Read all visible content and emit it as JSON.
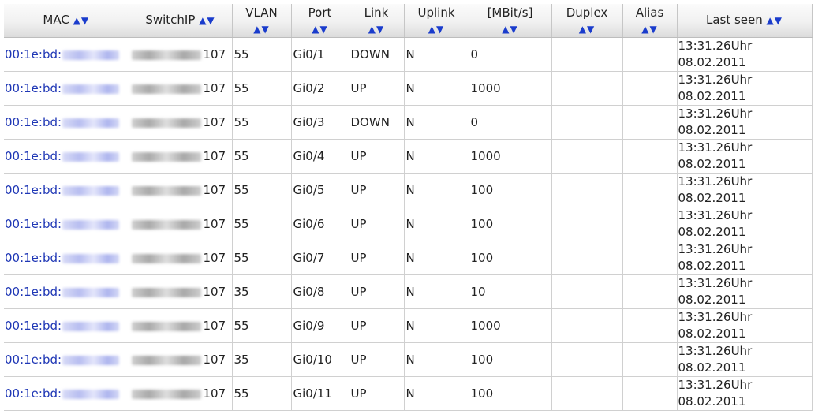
{
  "table": {
    "headers": {
      "mac": "MAC",
      "switchip": "SwitchIP",
      "vlan": "VLAN",
      "port": "Port",
      "link": "Link",
      "uplink": "Uplink",
      "speed": "[MBit/s]",
      "duplex": "Duplex",
      "alias": "Alias",
      "last_seen": "Last seen"
    },
    "sort_arrows": "▲▼",
    "rows": [
      {
        "mac_prefix": "00:1e:bd:",
        "ip_suffix": "107",
        "vlan": "55",
        "port": "Gi0/1",
        "link": "DOWN",
        "uplink": "N",
        "speed": "0",
        "duplex": "",
        "alias": "",
        "time": "13:31.26Uhr",
        "date": "08.02.2011"
      },
      {
        "mac_prefix": "00:1e:bd:",
        "ip_suffix": "107",
        "vlan": "55",
        "port": "Gi0/2",
        "link": "UP",
        "uplink": "N",
        "speed": "1000",
        "duplex": "",
        "alias": "",
        "time": "13:31.26Uhr",
        "date": "08.02.2011"
      },
      {
        "mac_prefix": "00:1e:bd:",
        "ip_suffix": "107",
        "vlan": "55",
        "port": "Gi0/3",
        "link": "DOWN",
        "uplink": "N",
        "speed": "0",
        "duplex": "",
        "alias": "",
        "time": "13:31.26Uhr",
        "date": "08.02.2011"
      },
      {
        "mac_prefix": "00:1e:bd:",
        "ip_suffix": "107",
        "vlan": "55",
        "port": "Gi0/4",
        "link": "UP",
        "uplink": "N",
        "speed": "1000",
        "duplex": "",
        "alias": "",
        "time": "13:31.26Uhr",
        "date": "08.02.2011"
      },
      {
        "mac_prefix": "00:1e:bd:",
        "ip_suffix": "107",
        "vlan": "55",
        "port": "Gi0/5",
        "link": "UP",
        "uplink": "N",
        "speed": "100",
        "duplex": "",
        "alias": "",
        "time": "13:31.26Uhr",
        "date": "08.02.2011"
      },
      {
        "mac_prefix": "00:1e:bd:",
        "ip_suffix": "107",
        "vlan": "55",
        "port": "Gi0/6",
        "link": "UP",
        "uplink": "N",
        "speed": "100",
        "duplex": "",
        "alias": "",
        "time": "13:31.26Uhr",
        "date": "08.02.2011"
      },
      {
        "mac_prefix": "00:1e:bd:",
        "ip_suffix": "107",
        "vlan": "55",
        "port": "Gi0/7",
        "link": "UP",
        "uplink": "N",
        "speed": "100",
        "duplex": "",
        "alias": "",
        "time": "13:31.26Uhr",
        "date": "08.02.2011"
      },
      {
        "mac_prefix": "00:1e:bd:",
        "ip_suffix": "107",
        "vlan": "35",
        "port": "Gi0/8",
        "link": "UP",
        "uplink": "N",
        "speed": "10",
        "duplex": "",
        "alias": "",
        "time": "13:31.26Uhr",
        "date": "08.02.2011"
      },
      {
        "mac_prefix": "00:1e:bd:",
        "ip_suffix": "107",
        "vlan": "55",
        "port": "Gi0/9",
        "link": "UP",
        "uplink": "N",
        "speed": "1000",
        "duplex": "",
        "alias": "",
        "time": "13:31.26Uhr",
        "date": "08.02.2011"
      },
      {
        "mac_prefix": "00:1e:bd:",
        "ip_suffix": "107",
        "vlan": "35",
        "port": "Gi0/10",
        "link": "UP",
        "uplink": "N",
        "speed": "100",
        "duplex": "",
        "alias": "",
        "time": "13:31.26Uhr",
        "date": "08.02.2011"
      },
      {
        "mac_prefix": "00:1e:bd:",
        "ip_suffix": "107",
        "vlan": "55",
        "port": "Gi0/11",
        "link": "UP",
        "uplink": "N",
        "speed": "100",
        "duplex": "",
        "alias": "",
        "time": "13:31.26Uhr",
        "date": "08.02.2011"
      }
    ]
  },
  "colors": {
    "link_text": "#1f37b5",
    "sort_arrow": "#1a3ccc",
    "header_bg": "#f1f1f1",
    "grid_line": "#d0d0d0"
  }
}
